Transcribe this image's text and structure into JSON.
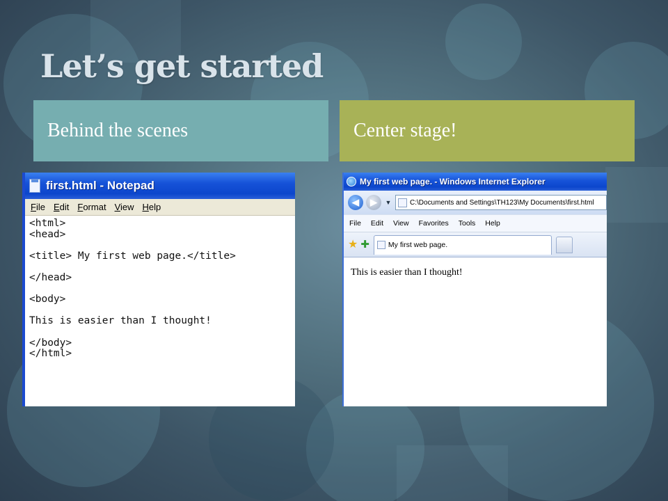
{
  "slide": {
    "title": "Let’s get started",
    "left_heading": "Behind the scenes",
    "right_heading": "Center stage!"
  },
  "notepad": {
    "title": "first.html - Notepad",
    "menu": [
      "File",
      "Edit",
      "Format",
      "View",
      "Help"
    ],
    "content": "<html>\n<head>\n\n<title> My first web page.</title>\n\n</head>\n\n<body>\n\nThis is easier than I thought!\n\n</body>\n</html>"
  },
  "browser": {
    "title": "My first web page. - Windows Internet Explorer",
    "address": "C:\\Documents and Settings\\TH123\\My Documents\\first.html",
    "menu": [
      "File",
      "Edit",
      "View",
      "Favorites",
      "Tools",
      "Help"
    ],
    "tab_label": "My first web page.",
    "page_text": "This is easier than I thought!"
  },
  "colors": {
    "left_heading_bg": "#76aeb0",
    "right_heading_bg": "#a8b257",
    "xp_titlebar": "#0c46cc"
  }
}
